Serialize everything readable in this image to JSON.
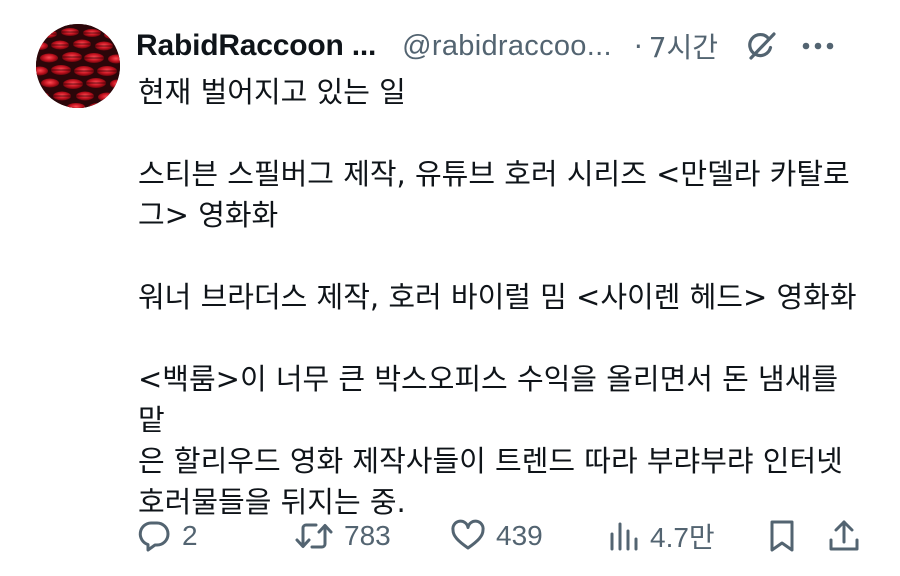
{
  "post": {
    "author": {
      "display_name": "RabidRaccoon ...",
      "handle": "@rabidraccoo...",
      "separator": "·",
      "time_ago": "7시간"
    },
    "text_lines": [
      "현재 벌어지고 있는 일",
      "",
      "스티븐 스필버그 제작, 유튜브 호러 시리즈 <만델라 카탈로",
      "그> 영화화",
      "",
      "워너 브라더스 제작, 호러 바이럴 밈 <사이렌 헤드> 영화화",
      "",
      "<백룸>이 너무 큰 박스오피스 수익을 올리면서 돈 냄새를 맡",
      "은 할리우드 영화 제작사들이 트렌드 따라 부랴부랴 인터넷",
      "호러물들을 뒤지는 중."
    ],
    "actions": {
      "reply_count": "2",
      "repost_count": "783",
      "like_count": "439",
      "views_count": "4.7만"
    },
    "icons": {
      "grok": "grok-icon",
      "more": "more-icon",
      "reply": "reply-icon",
      "repost": "repost-icon",
      "like": "like-icon",
      "views": "views-icon",
      "bookmark": "bookmark-icon",
      "share": "share-icon"
    },
    "colors": {
      "text": "#0f1419",
      "secondary": "#536471",
      "background": "#ffffff"
    }
  }
}
